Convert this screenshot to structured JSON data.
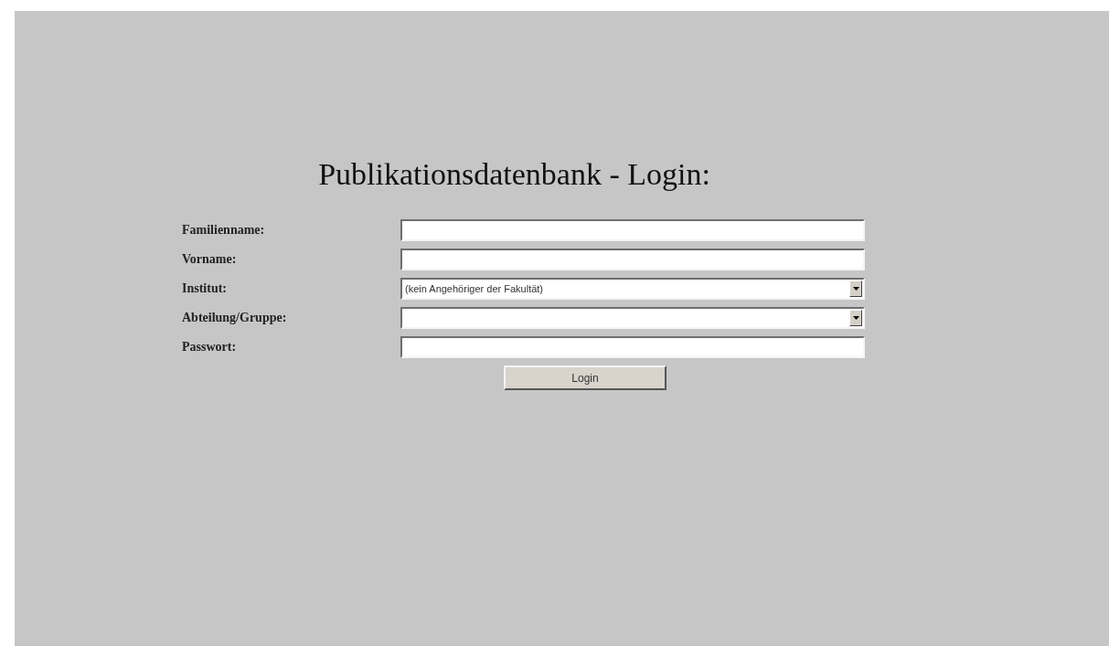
{
  "title": "Publikationsdatenbank - Login:",
  "fields": [
    {
      "label": "Familienname:",
      "kind": "text"
    },
    {
      "label": "Vorname:",
      "kind": "text"
    },
    {
      "label": "Institut:",
      "kind": "select",
      "value": "(kein Angehöriger der Fakultät)"
    },
    {
      "label": "Abteilung/Gruppe:",
      "kind": "select"
    },
    {
      "label": "Passwort:",
      "kind": "password"
    }
  ],
  "button": "Login"
}
